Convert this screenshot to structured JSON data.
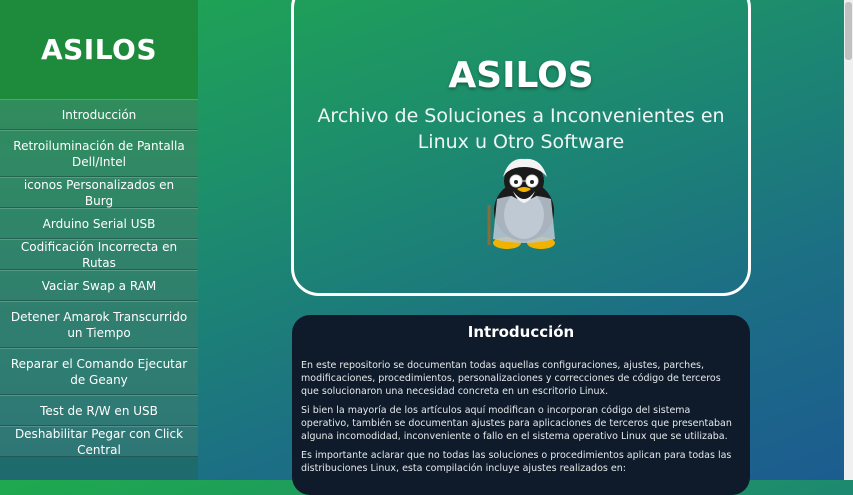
{
  "sidebar": {
    "title": "ASILOS",
    "items": [
      {
        "label": "Introducción"
      },
      {
        "label": "Retroiluminación de Pantalla Dell/Intel"
      },
      {
        "label": "iconos Personalizados en Burg"
      },
      {
        "label": "Arduino Serial USB"
      },
      {
        "label": "Codificación Incorrecta en Rutas"
      },
      {
        "label": "Vaciar Swap a RAM"
      },
      {
        "label": "Detener Amarok Transcurrido un Tiempo"
      },
      {
        "label": "Reparar el Comando Ejecutar de Geany"
      },
      {
        "label": "Test de R/W en USB"
      },
      {
        "label": "Deshabilitar Pegar con Click Central"
      }
    ]
  },
  "hero": {
    "title": "ASILOS",
    "subtitle": "Archivo de Soluciones a Inconvenientes en Linux u Otro Software"
  },
  "intro": {
    "heading": "Introducción",
    "paragraphs": [
      "En este repositorio se documentan todas aquellas configuraciones, ajustes, parches, modificaciones, procedimientos, personalizaciones y correcciones de código de terceros que solucionaron una necesidad concreta en un escritorio Linux.",
      "Si bien la mayoría de los artículos aquí modifican o incorporan código del sistema operativo, también se documentan ajustes para aplicaciones de terceros que presentaban alguna incomodidad, inconveniente o fallo en el sistema operativo Linux que se utilizaba.",
      "Es importante aclarar que no todas las soluciones o procedimientos aplican para todas las distribuciones Linux, esta compilación incluye ajustes realizados en:"
    ]
  },
  "icons": {
    "logo": "tux-old-man-icon"
  }
}
